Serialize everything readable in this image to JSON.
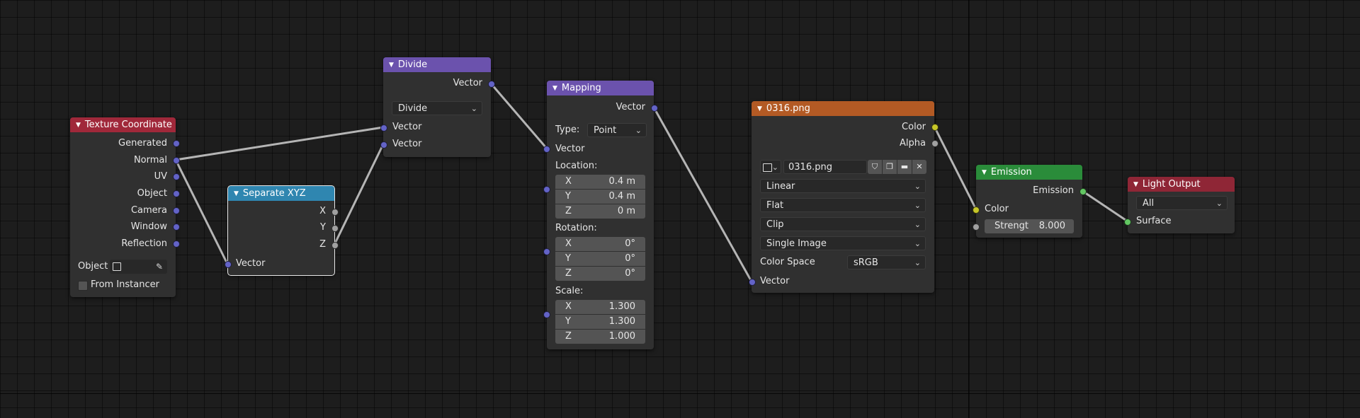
{
  "colors": {
    "background": "#1d1d1d",
    "node_body": "#303030",
    "header_texture_coordinate": "#a0283a",
    "header_separate_xyz": "#2f86b0",
    "header_divide": "#6b52ad",
    "header_mapping": "#6b52ad",
    "header_image": "#b35a24",
    "header_emission": "#2a8c3a",
    "header_light_output": "#8f2636",
    "socket_vector": "#6363c7",
    "socket_color": "#c7c729",
    "socket_float": "#a1a1a1",
    "socket_shader": "#63c763",
    "wire": "#b5b5b5"
  },
  "nodes": {
    "texture_coordinate": {
      "title": "Texture Coordinate",
      "outputs": [
        "Generated",
        "Normal",
        "UV",
        "Object",
        "Camera",
        "Window",
        "Reflection"
      ],
      "object_label": "Object",
      "eyedropper_icon": "eyedropper-icon",
      "from_instancer_label": "From Instancer",
      "from_instancer_checked": false
    },
    "separate_xyz": {
      "title": "Separate XYZ",
      "outputs": [
        "X",
        "Y",
        "Z"
      ],
      "input": "Vector"
    },
    "divide": {
      "title": "Divide",
      "output": "Vector",
      "operation": "Divide",
      "inputs": [
        "Vector",
        "Vector"
      ]
    },
    "mapping": {
      "title": "Mapping",
      "output": "Vector",
      "type_label": "Type:",
      "type_value": "Point",
      "input": "Vector",
      "location_label": "Location:",
      "location": [
        {
          "axis": "X",
          "value": "0.4 m"
        },
        {
          "axis": "Y",
          "value": "0.4 m"
        },
        {
          "axis": "Z",
          "value": "0 m"
        }
      ],
      "rotation_label": "Rotation:",
      "rotation": [
        {
          "axis": "X",
          "value": "0°"
        },
        {
          "axis": "Y",
          "value": "0°"
        },
        {
          "axis": "Z",
          "value": "0°"
        }
      ],
      "scale_label": "Scale:",
      "scale": [
        {
          "axis": "X",
          "value": "1.300"
        },
        {
          "axis": "Y",
          "value": "1.300"
        },
        {
          "axis": "Z",
          "value": "1.000"
        }
      ]
    },
    "image_texture": {
      "title": "0316.png",
      "outputs": [
        "Color",
        "Alpha"
      ],
      "image_name": "0316.png",
      "interpolation": "Linear",
      "projection": "Flat",
      "extension": "Clip",
      "source": "Single Image",
      "color_space_label": "Color Space",
      "color_space": "sRGB",
      "input": "Vector"
    },
    "emission": {
      "title": "Emission",
      "output": "Emission",
      "color_label": "Color",
      "strength_label": "Strengt",
      "strength_value": "8.000"
    },
    "light_output": {
      "title": "Light Output",
      "target": "All",
      "input": "Surface"
    }
  }
}
